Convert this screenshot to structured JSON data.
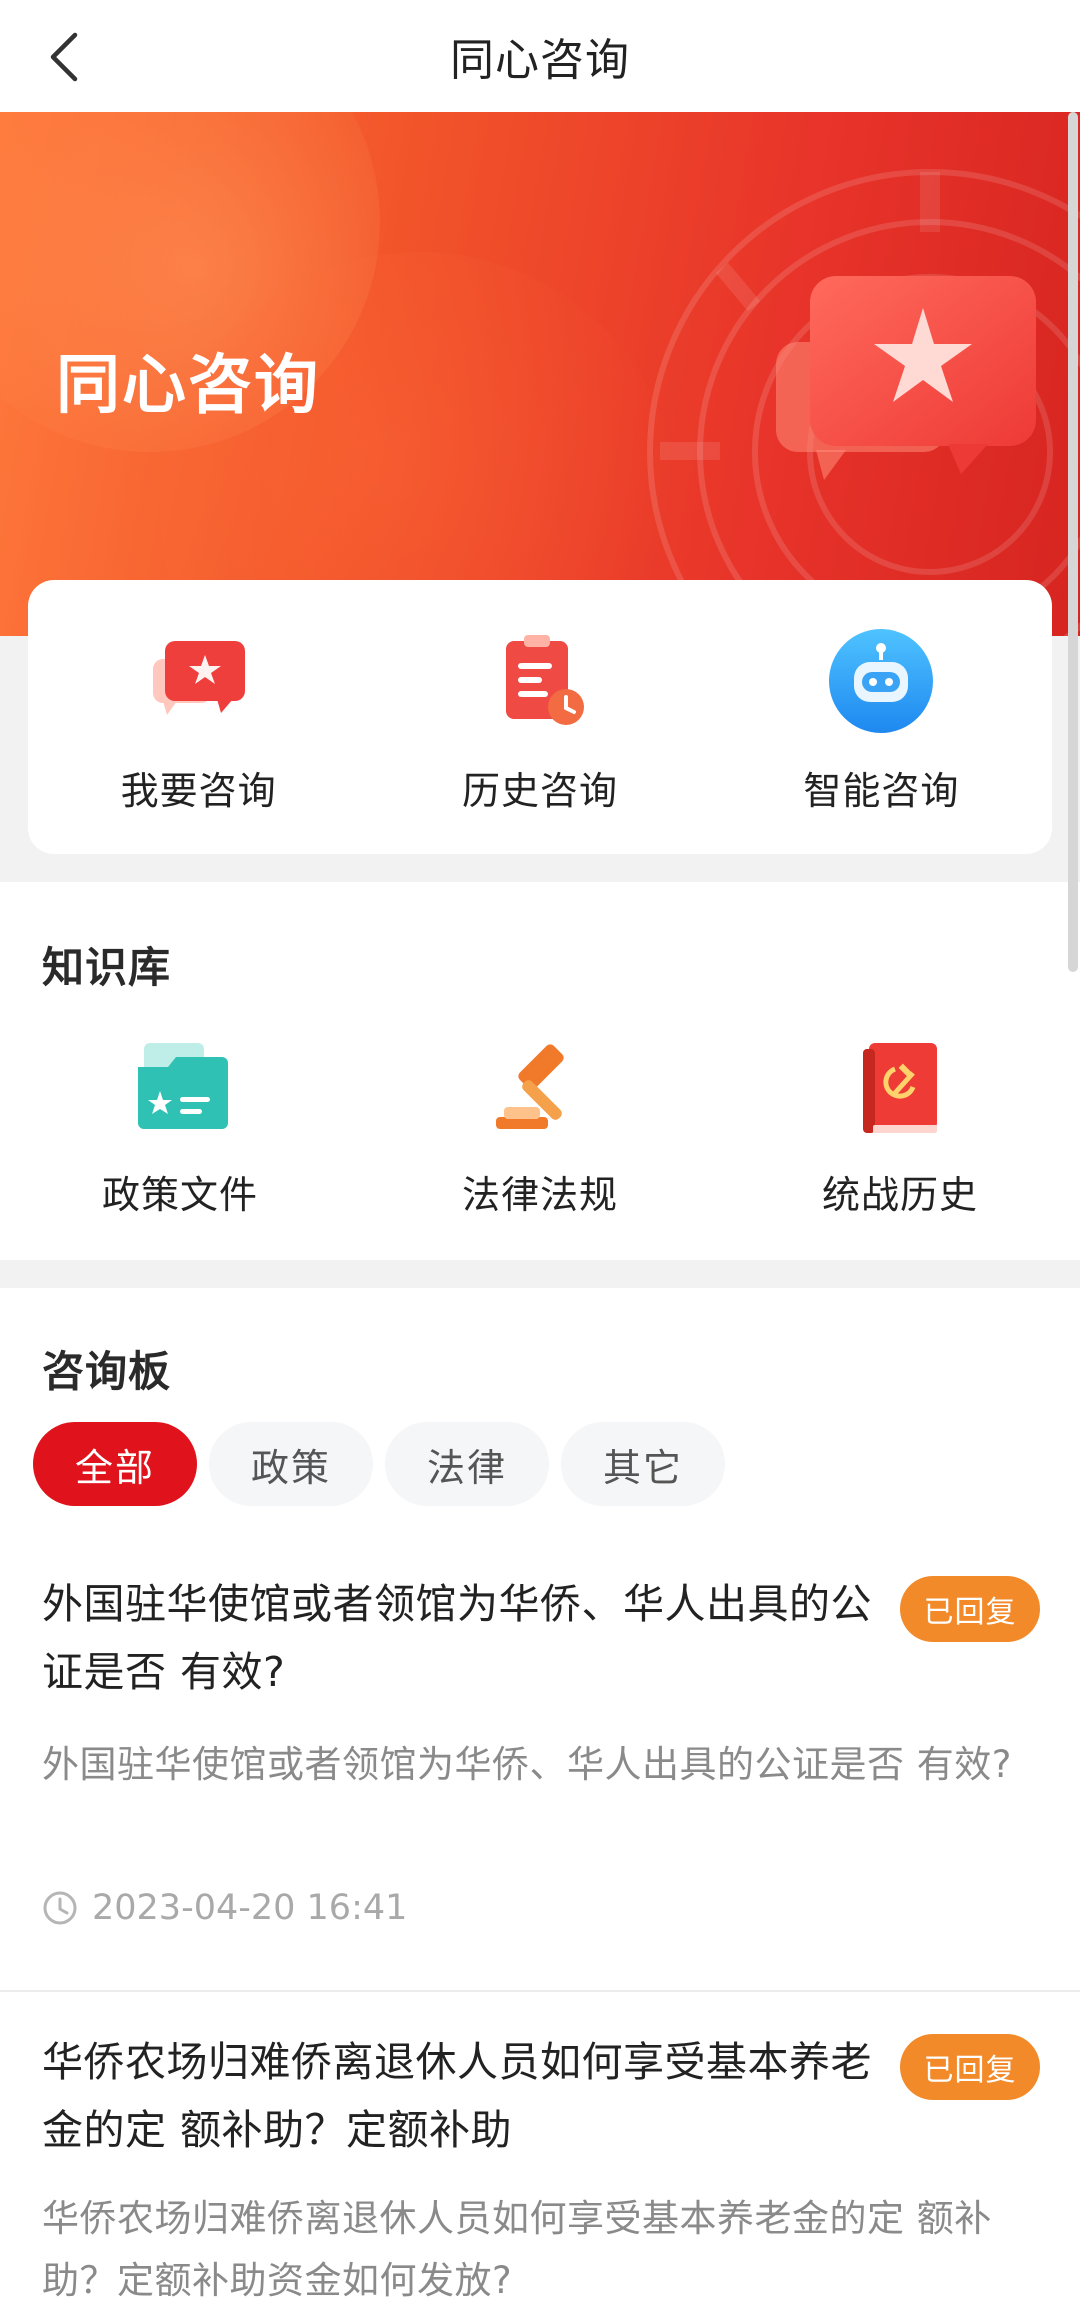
{
  "navbar": {
    "title": "同心咨询",
    "back_icon": "chevron-left-icon"
  },
  "hero": {
    "title": "同心咨询",
    "bubble_icon": "chat-star-icon"
  },
  "quick_actions": [
    {
      "label": "我要咨询",
      "icon": "chat-star-icon"
    },
    {
      "label": "历史咨询",
      "icon": "clipboard-clock-icon"
    },
    {
      "label": "智能咨询",
      "icon": "robot-icon"
    }
  ],
  "knowledge": {
    "title": "知识库",
    "items": [
      {
        "label": "政策文件",
        "icon": "folder-star-icon"
      },
      {
        "label": "法律法规",
        "icon": "gavel-icon"
      },
      {
        "label": "统战历史",
        "icon": "party-book-icon"
      }
    ]
  },
  "board": {
    "title": "咨询板",
    "filters": [
      "全部",
      "政策",
      "法律",
      "其它"
    ],
    "active_filter": "全部",
    "posts": [
      {
        "title": "外国驻华使馆或者领馆为华侨、华人出具的公证是否 有效?",
        "status": "已回复",
        "desc": "外国驻华使馆或者领馆为华侨、华人出具的公证是否 有效?",
        "time": "2023-04-20 16:41"
      },
      {
        "title": "华侨农场归难侨离退休人员如何享受基本养老金的定 额补助？定额补助",
        "status": "已回复",
        "desc": "华侨农场归难侨离退休人员如何享受基本养老金的定 额补助？定额补助资金如何发放?"
      }
    ]
  },
  "colors": {
    "primary_red": "#e0121c",
    "badge_orange": "#f38a2a",
    "hero_orange": "#f2552a"
  }
}
